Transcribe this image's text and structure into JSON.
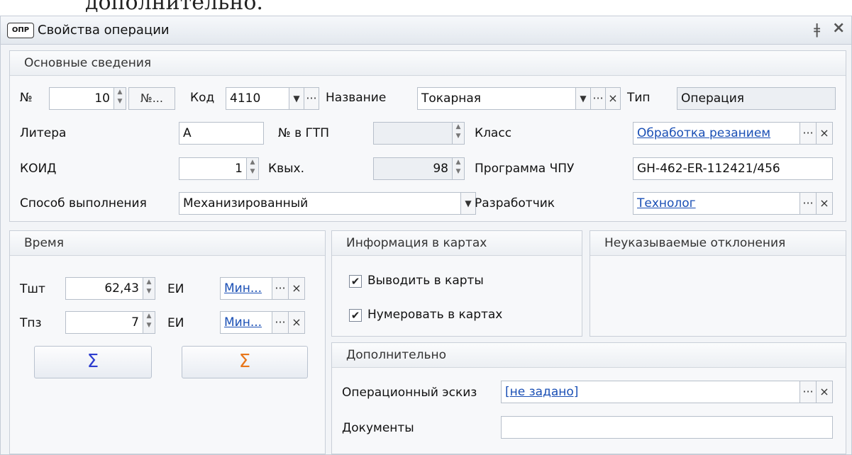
{
  "top_text": "дополнительно.",
  "window": {
    "icon_label": "ОПР",
    "title": "Свойства операции",
    "pin_icon": "pin-icon",
    "close_icon": "close-icon"
  },
  "main": {
    "header": "Основные сведения",
    "no_label": "№",
    "no_value": "10",
    "no_button": "№...",
    "code_label": "Код",
    "code_value": "4110",
    "name_label": "Название",
    "name_value": "Токарная",
    "type_label": "Тип",
    "type_value": "Операция",
    "litera_label": "Литера",
    "litera_value": "А",
    "gtp_label": "№ в ГТП",
    "gtp_value": "",
    "class_label": "Класс",
    "class_value": "Обработка резанием",
    "koid_label": "КОИД",
    "koid_value": "1",
    "kvyh_label": "Квых.",
    "kvyh_value": "98",
    "chpu_label": "Программа ЧПУ",
    "chpu_value": "GH-462-ER-112421/456",
    "method_label": "Способ выполнения",
    "method_value": "Механизированный",
    "developer_label": "Разработчик",
    "developer_value": "Технолог"
  },
  "time": {
    "header": "Время",
    "tsht_label": "Тшт",
    "tsht_value": "62,43",
    "tsht_unit_label": "ЕИ",
    "tsht_unit_value": "Мин...",
    "tpz_label": "Тпз",
    "tpz_value": "7",
    "tpz_unit_label": "ЕИ",
    "tpz_unit_value": "Мин...",
    "sum_blue": "Σ",
    "sum_orange": "Σ"
  },
  "cards": {
    "header": "Информация в картах",
    "output_label": "Выводить в карты",
    "output_checked": true,
    "number_label": "Нумеровать в картах",
    "number_checked": true
  },
  "deviations": {
    "header": "Неуказываемые отклонения"
  },
  "additional": {
    "header": "Дополнительно",
    "sketch_label": "Операционный эскиз",
    "sketch_value": "[не задано]",
    "docs_label": "Документы",
    "docs_value": ""
  },
  "colors": {
    "sum_blue": "#2c3ccf",
    "sum_orange": "#e8761a",
    "link": "#1a4fb5"
  }
}
